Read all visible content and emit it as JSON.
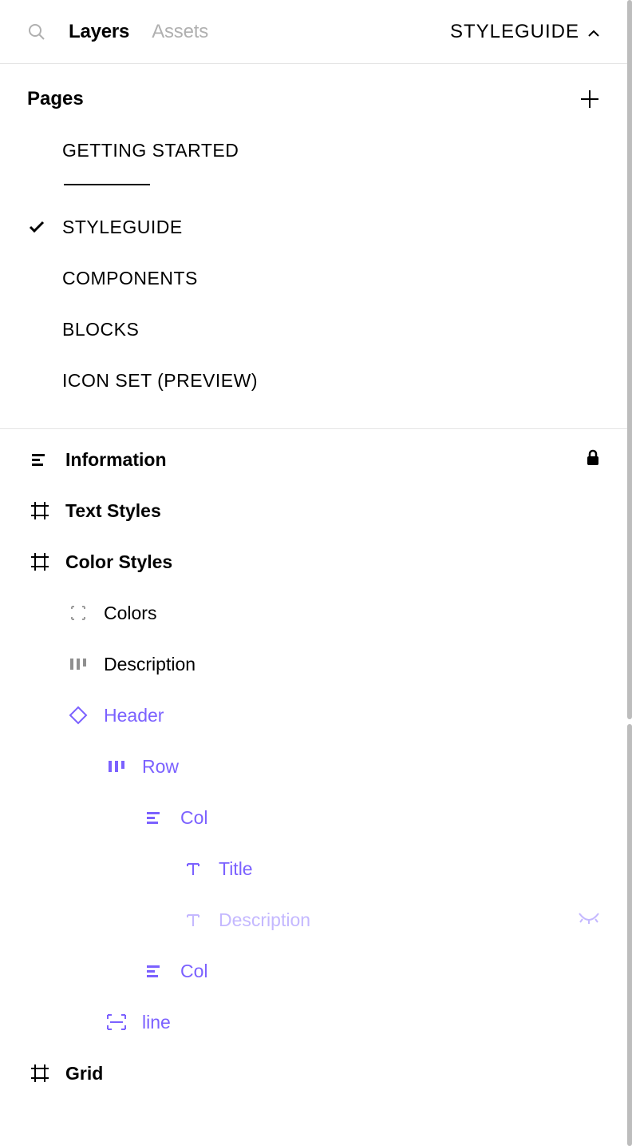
{
  "topbar": {
    "tabs": {
      "layers": "Layers",
      "assets": "Assets"
    },
    "current_page": "STYLEGUIDE"
  },
  "pages": {
    "heading": "Pages",
    "items": [
      {
        "name": "GETTING STARTED",
        "selected": false,
        "is_divider": false
      },
      {
        "is_divider": true
      },
      {
        "name": "STYLEGUIDE",
        "selected": true,
        "is_divider": false
      },
      {
        "name": "COMPONENTS",
        "selected": false,
        "is_divider": false
      },
      {
        "name": "BLOCKS",
        "selected": false,
        "is_divider": false
      },
      {
        "name": "ICON SET (PREVIEW)",
        "selected": false,
        "is_divider": false
      }
    ]
  },
  "layers": [
    {
      "name": "Information",
      "depth": 0,
      "icon": "text-block",
      "style": "bold",
      "locked": true
    },
    {
      "name": "Text Styles",
      "depth": 0,
      "icon": "frame",
      "style": "bold"
    },
    {
      "name": "Color Styles",
      "depth": 0,
      "icon": "frame",
      "style": "bold"
    },
    {
      "name": "Colors",
      "depth": 1,
      "icon": "slice",
      "style": "normal"
    },
    {
      "name": "Description",
      "depth": 1,
      "icon": "autolayout-h",
      "style": "normal"
    },
    {
      "name": "Header",
      "depth": 1,
      "icon": "component",
      "style": "comp"
    },
    {
      "name": "Row",
      "depth": 2,
      "icon": "autolayout-h-purple",
      "style": "comp"
    },
    {
      "name": "Col",
      "depth": 3,
      "icon": "autolayout-v-purple",
      "style": "comp"
    },
    {
      "name": "Title",
      "depth": 4,
      "icon": "text-purple",
      "style": "comp"
    },
    {
      "name": "Description",
      "depth": 4,
      "icon": "text-purple-faded",
      "style": "comp-faded",
      "hidden": true
    },
    {
      "name": "Col",
      "depth": 3,
      "icon": "autolayout-v-purple",
      "style": "comp"
    },
    {
      "name": "line",
      "depth": 2,
      "icon": "line-frame-purple",
      "style": "comp"
    },
    {
      "name": "Grid",
      "depth": 0,
      "icon": "frame",
      "style": "bold"
    }
  ]
}
